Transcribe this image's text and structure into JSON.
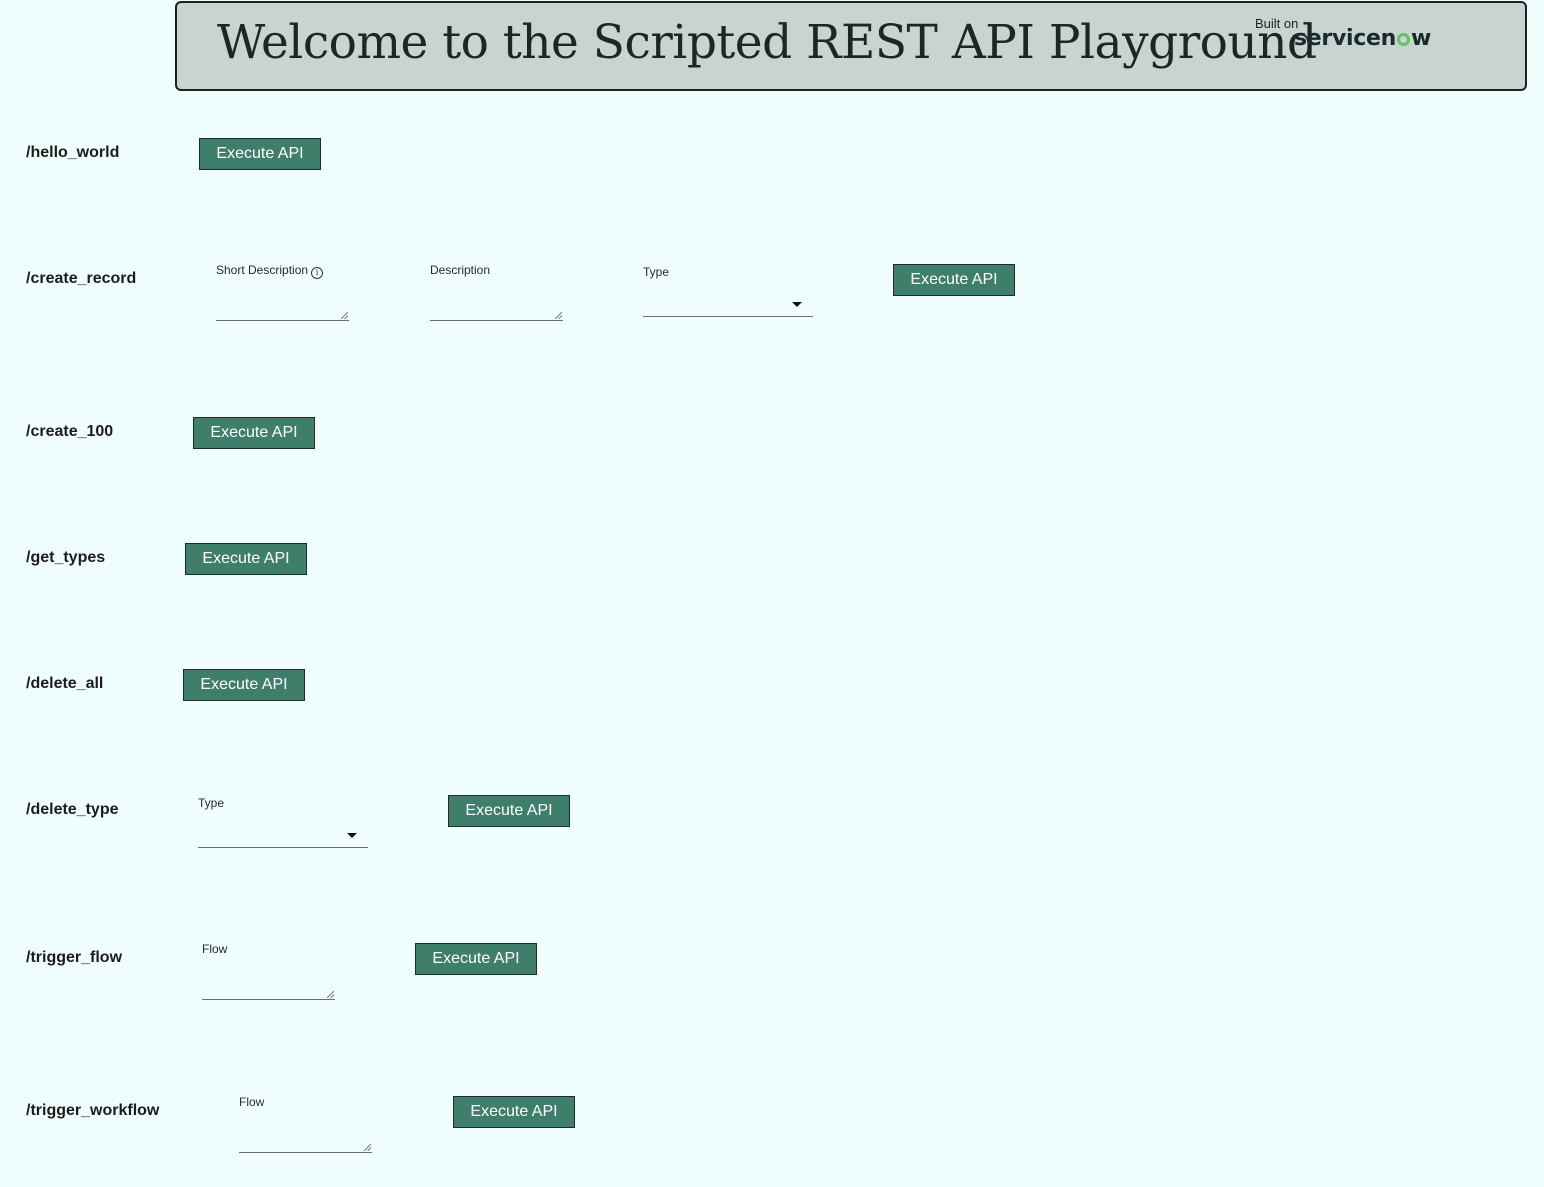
{
  "header": {
    "title": "Welcome to the Scripted REST API Playground",
    "built_on": "Built on",
    "logo": {
      "pre": "servicen",
      "post": "w",
      "accent_color": "#5fc45a"
    }
  },
  "colors": {
    "background": "#f0fdfd",
    "header_bg": "#c8d4d2",
    "button_bg": "#3e7e6b",
    "button_text": "#ffffff"
  },
  "endpoints": {
    "hello_world": {
      "route": "/hello_world",
      "button_label": "Execute API"
    },
    "create_record": {
      "route": "/create_record",
      "short_description_label": "Short Description",
      "short_description_value": "",
      "description_label": "Description",
      "description_value": "",
      "type_label": "Type",
      "type_value": "",
      "button_label": "Execute API"
    },
    "create_100": {
      "route": "/create_100",
      "button_label": "Execute API"
    },
    "get_types": {
      "route": "/get_types",
      "button_label": "Execute API"
    },
    "delete_all": {
      "route": "/delete_all",
      "button_label": "Execute API"
    },
    "delete_type": {
      "route": "/delete_type",
      "type_label": "Type",
      "type_value": "",
      "button_label": "Execute API"
    },
    "trigger_flow": {
      "route": "/trigger_flow",
      "flow_label": "Flow",
      "flow_value": "",
      "button_label": "Execute API"
    },
    "trigger_workflow": {
      "route": "/trigger_workflow",
      "flow_label": "Flow",
      "flow_value": "",
      "button_label": "Execute API"
    }
  }
}
